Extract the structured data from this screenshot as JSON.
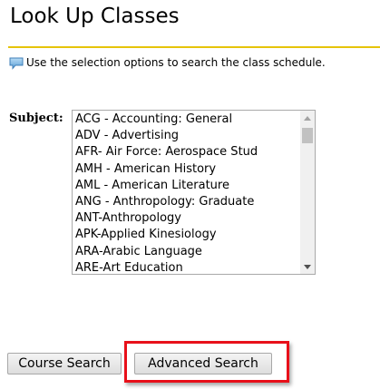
{
  "page": {
    "title": "Look Up Classes",
    "rule_color": "#e6c40a"
  },
  "info": {
    "icon": "speech-bubble-icon",
    "text": "Use the selection options to search the class schedule."
  },
  "subject": {
    "label": "Subject:",
    "options": [
      "ACG - Accounting: General",
      "ADV - Advertising",
      "AFR- Air Force: Aerospace Stud",
      "AMH - American History",
      "AML - American Literature",
      "ANG - Anthropology: Graduate",
      "ANT-Anthropology",
      "APK-Applied Kinesiology",
      "ARA-Arabic Language",
      "ARE-Art Education"
    ]
  },
  "buttons": {
    "course_search": "Course Search",
    "advanced_search": "Advanced Search"
  },
  "highlight": {
    "color": "#e8101a"
  }
}
